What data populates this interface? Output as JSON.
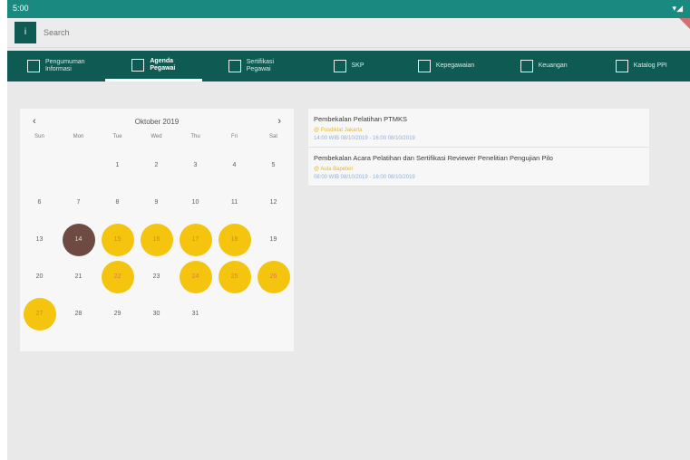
{
  "status": {
    "time": "5:00",
    "signal": "▾◢"
  },
  "search": {
    "placeholder": "Search"
  },
  "nav": [
    {
      "line1": "Pengumuman",
      "line2": "Informasi",
      "icon": "newspaper-icon"
    },
    {
      "line1": "Agenda",
      "line2": "Pegawai",
      "icon": "calendar-icon"
    },
    {
      "line1": "Sertifikasi",
      "line2": "Pegawai",
      "icon": "certificate-icon"
    },
    {
      "line1": "SKP",
      "line2": "",
      "icon": "chart-icon"
    },
    {
      "line1": "Kepegawaian",
      "line2": "",
      "icon": "person-icon"
    },
    {
      "line1": "Keuangan",
      "line2": "",
      "icon": "card-icon"
    },
    {
      "line1": "Katalog PPI",
      "line2": "",
      "icon": "qr-icon"
    }
  ],
  "calendar": {
    "title": "Oktober 2019",
    "prev": "‹",
    "next": "›",
    "weekdays": [
      "Sun",
      "Mon",
      "Tue",
      "Wed",
      "Thu",
      "Fri",
      "Sat"
    ],
    "cells": [
      "",
      "",
      "1",
      "2",
      "3",
      "4",
      "5",
      "6",
      "7",
      "8",
      "9",
      "10",
      "11",
      "12",
      "13",
      "14",
      "15",
      "16",
      "17",
      "18",
      "19",
      "20",
      "21",
      "22",
      "23",
      "24",
      "25",
      "26",
      "27",
      "28",
      "29",
      "30",
      "31",
      "",
      ""
    ],
    "event_days": [
      "15",
      "16",
      "17",
      "18",
      "22",
      "24",
      "25",
      "26",
      "27"
    ],
    "today": "14"
  },
  "events": [
    {
      "title": "Pembekalan Pelatihan PTMKS",
      "location": "@ Pusdiklat Jakarta",
      "time": "14:00 WIB 08/10/2019 - 16:00 08/10/2019"
    },
    {
      "title": "Pembekalan Acara Pelatihan dan Sertifikasi Reviewer Penelitian Pengujian Pilo",
      "location": "@ Aula Bapeten",
      "time": "08:00 WIB 08/10/2019 - 16:00 08/10/2019"
    }
  ],
  "colors": {
    "statusbar": "#1a8a80",
    "navbar": "#0f5a52",
    "event_day": "#f4c40f",
    "today": "#6e4b42"
  }
}
